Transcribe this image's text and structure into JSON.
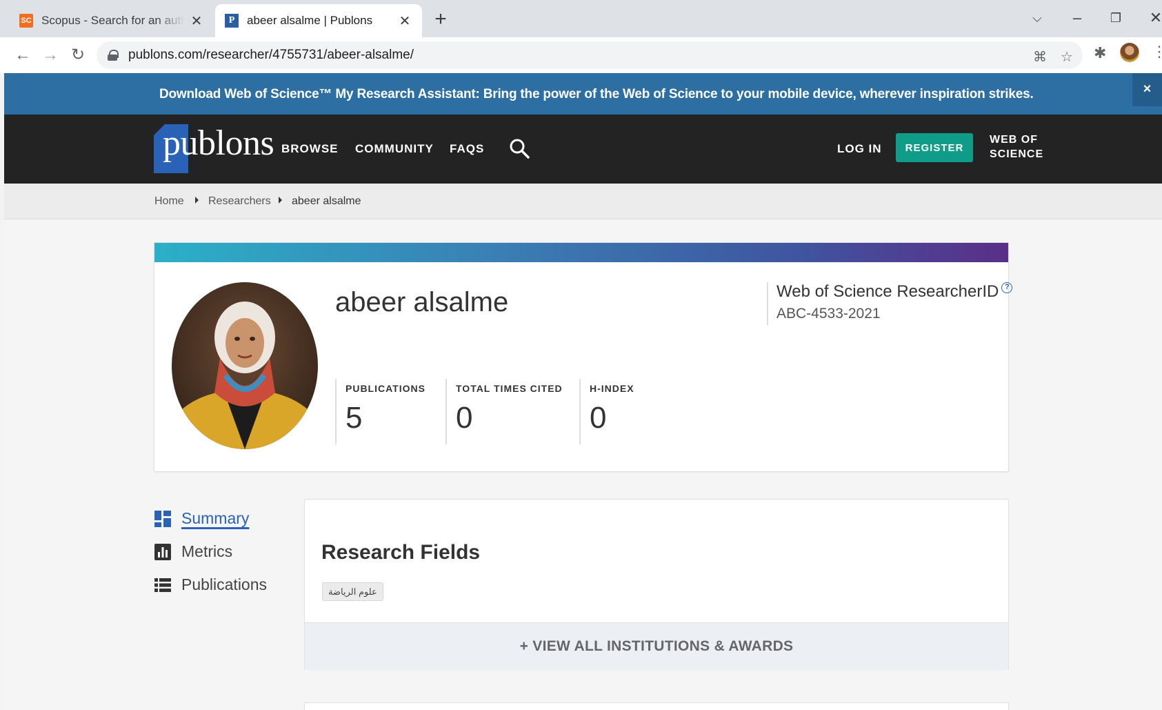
{
  "browser": {
    "tabs": [
      {
        "favicon": "SC",
        "title": "Scopus - Search for an author profile",
        "active": false
      },
      {
        "favicon": "P",
        "title": "abeer alsalme | Publons",
        "active": true
      }
    ],
    "new_tab": "+",
    "url": "publons.com/researcher/4755731/abeer-alsalme/"
  },
  "banner": {
    "text": "Download Web of Science™ My Research Assistant: Bring the power of the Web of Science to your mobile device, wherever inspiration strikes.",
    "close": "×"
  },
  "nav": {
    "logo": "publons",
    "links": [
      "BROWSE",
      "COMMUNITY",
      "FAQS"
    ],
    "login": "LOG IN",
    "register": "REGISTER",
    "web_of_science_line1": "WEB OF",
    "web_of_science_line2": "SCIENCE"
  },
  "breadcrumb": [
    "Home",
    "Researchers",
    "abeer alsalme"
  ],
  "profile": {
    "name": "abeer alsalme",
    "researcher_id_label": "Web of Science ResearcherID",
    "researcher_id_help": "?",
    "researcher_id": "ABC-4533-2021",
    "metrics": [
      {
        "label": "PUBLICATIONS",
        "value": "5"
      },
      {
        "label": "TOTAL TIMES CITED",
        "value": "0"
      },
      {
        "label": "H-INDEX",
        "value": "0"
      }
    ]
  },
  "sidenav": [
    {
      "label": "Summary",
      "icon": "dashboard-icon",
      "active": true
    },
    {
      "label": "Metrics",
      "icon": "bar-chart-icon",
      "active": false
    },
    {
      "label": "Publications",
      "icon": "list-icon",
      "active": false
    }
  ],
  "research_fields": {
    "title": "Research Fields",
    "tags": [
      "علوم الرياضة"
    ],
    "view_all": "+ VIEW ALL INSTITUTIONS & AWARDS"
  },
  "colors": {
    "banner": "#2d6ea3",
    "navbar": "#232323",
    "register": "#0f9d8a",
    "accent": "#2a62b8"
  }
}
